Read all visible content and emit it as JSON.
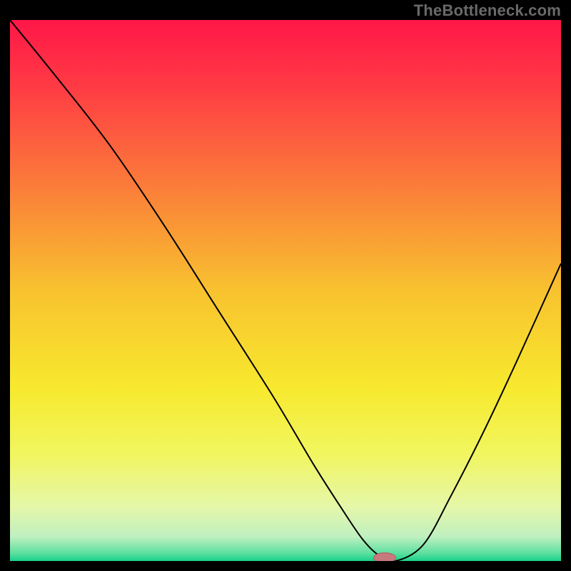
{
  "watermark": "TheBottleneck.com",
  "colors": {
    "black": "#000000",
    "curve": "#000000",
    "marker_fill": "#c77a7e",
    "marker_stroke": "#b46166"
  },
  "chart_data": {
    "type": "line",
    "title": "",
    "xlabel": "",
    "ylabel": "",
    "xlim": [
      0,
      100
    ],
    "ylim": [
      0,
      100
    ],
    "gradient_stops": [
      {
        "offset": 0.0,
        "color": "#ff1748"
      },
      {
        "offset": 0.12,
        "color": "#ff3a44"
      },
      {
        "offset": 0.3,
        "color": "#fb7a3a"
      },
      {
        "offset": 0.5,
        "color": "#f8c22f"
      },
      {
        "offset": 0.68,
        "color": "#f7e92e"
      },
      {
        "offset": 0.8,
        "color": "#f1f65e"
      },
      {
        "offset": 0.9,
        "color": "#e5f7a9"
      },
      {
        "offset": 0.955,
        "color": "#bff0c0"
      },
      {
        "offset": 0.985,
        "color": "#5fe0a0"
      },
      {
        "offset": 1.0,
        "color": "#19d18a"
      }
    ],
    "series": [
      {
        "name": "bottleneck-curve",
        "x": [
          0,
          8,
          18,
          28,
          38,
          48,
          55,
          60,
          64,
          67,
          70,
          75,
          80,
          86,
          92,
          100
        ],
        "y": [
          100,
          90,
          77,
          62,
          46,
          30,
          18,
          10,
          4,
          1,
          0,
          3,
          12,
          24,
          37,
          55
        ]
      }
    ],
    "marker": {
      "x": 68,
      "y": 0,
      "rx": 2.0,
      "ry": 0.9
    },
    "annotations": []
  }
}
